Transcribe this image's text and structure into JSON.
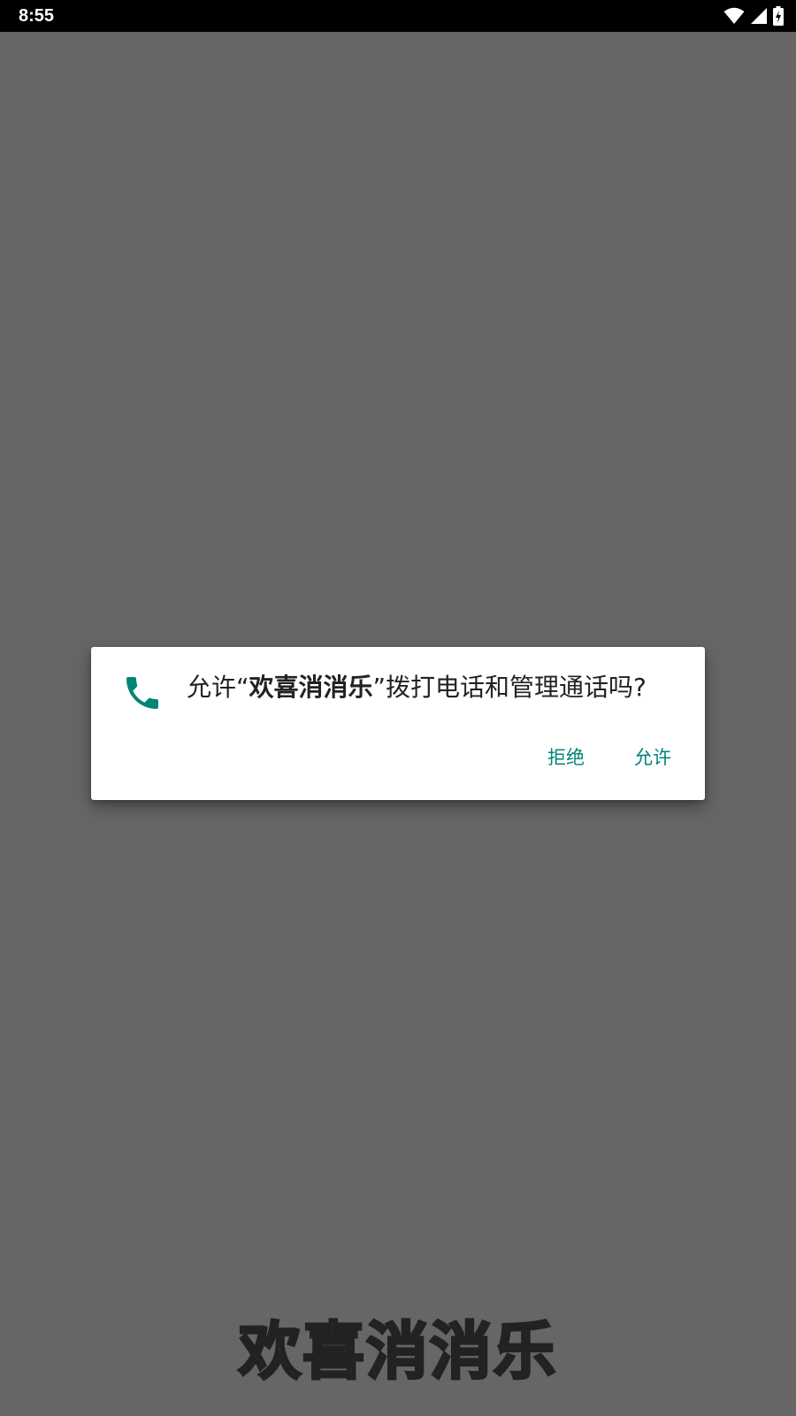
{
  "status_bar": {
    "time": "8:55",
    "icons": [
      "wifi-icon",
      "cell-signal-icon",
      "battery-charging-icon"
    ]
  },
  "dialog": {
    "icon": "phone-icon",
    "message_prefix": "允许“",
    "app_name": "欢喜消消乐",
    "message_suffix": "”拨打电话和管理通话吗?",
    "deny_label": "拒绝",
    "allow_label": "允许"
  },
  "background": {
    "app_title": "欢喜消消乐"
  },
  "colors": {
    "accent": "#008577",
    "scrim": "#666666",
    "status_bar": "#000000"
  }
}
